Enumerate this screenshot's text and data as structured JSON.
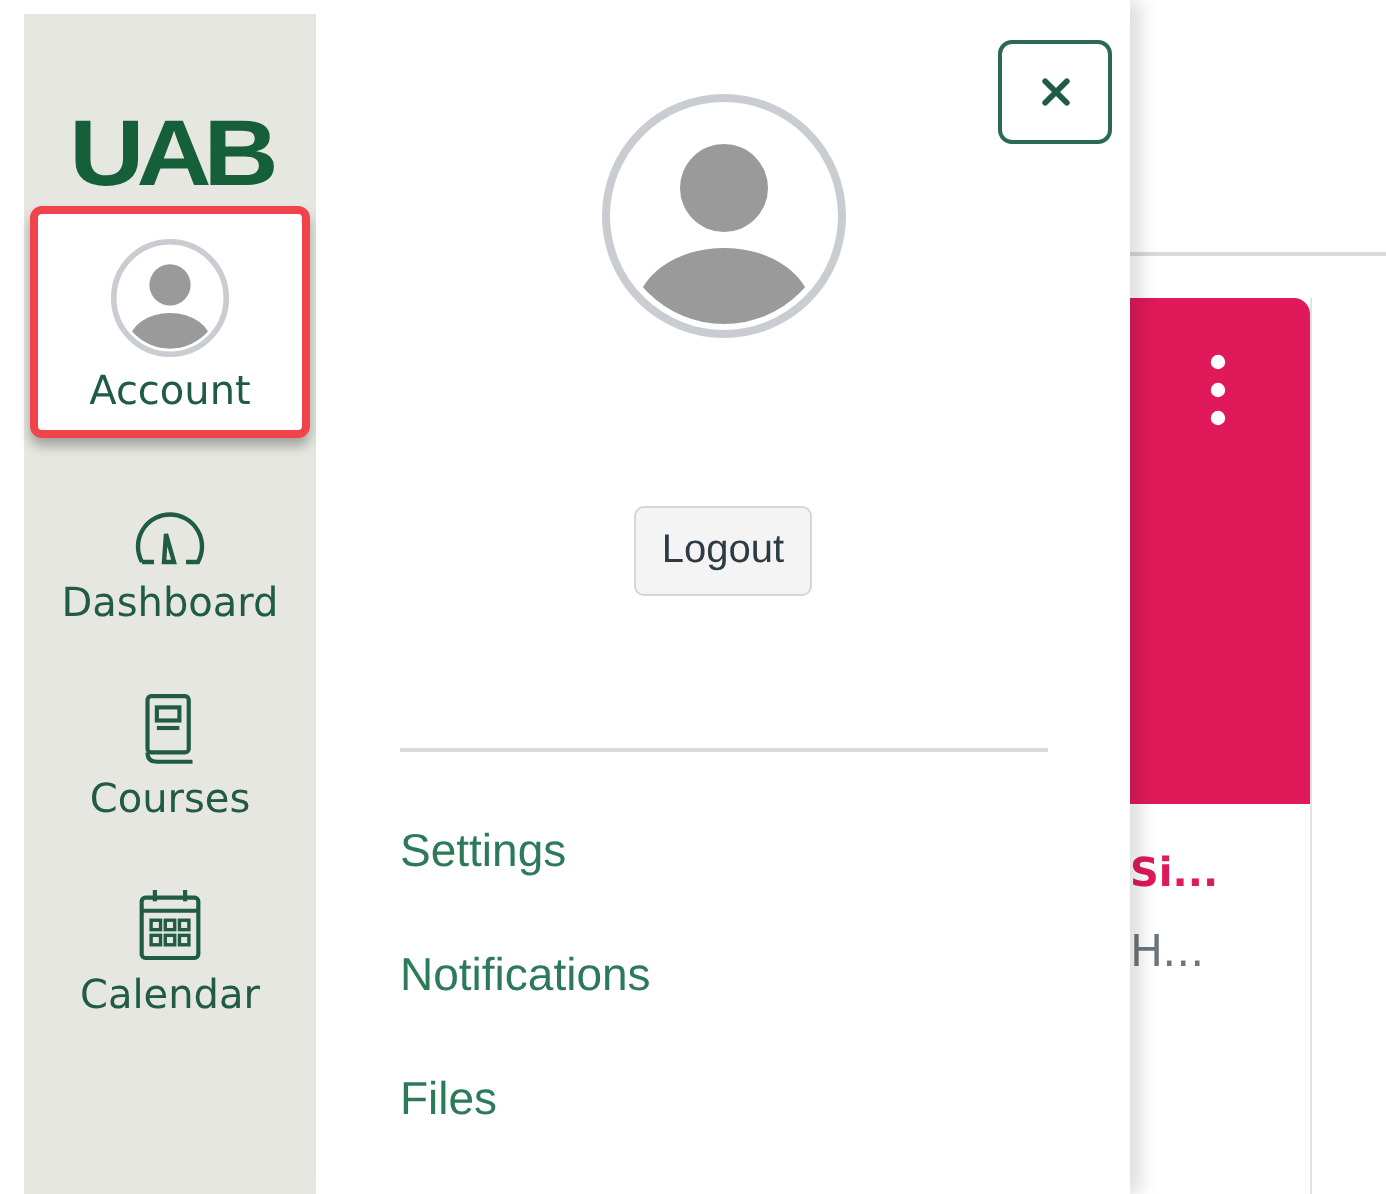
{
  "logo": {
    "text": "UAB"
  },
  "nav": [
    {
      "kind": "account",
      "label": "Account",
      "selected": true
    },
    {
      "kind": "dashboard",
      "label": "Dashboard",
      "selected": false
    },
    {
      "kind": "courses",
      "label": "Courses",
      "selected": false
    },
    {
      "kind": "calendar",
      "label": "Calendar",
      "selected": false
    }
  ],
  "tray": {
    "logout": "Logout",
    "links": [
      "Settings",
      "Notifications",
      "Files"
    ]
  },
  "course_card": {
    "title": "Si...",
    "subtitle": "H...",
    "color": "#e0195a"
  }
}
